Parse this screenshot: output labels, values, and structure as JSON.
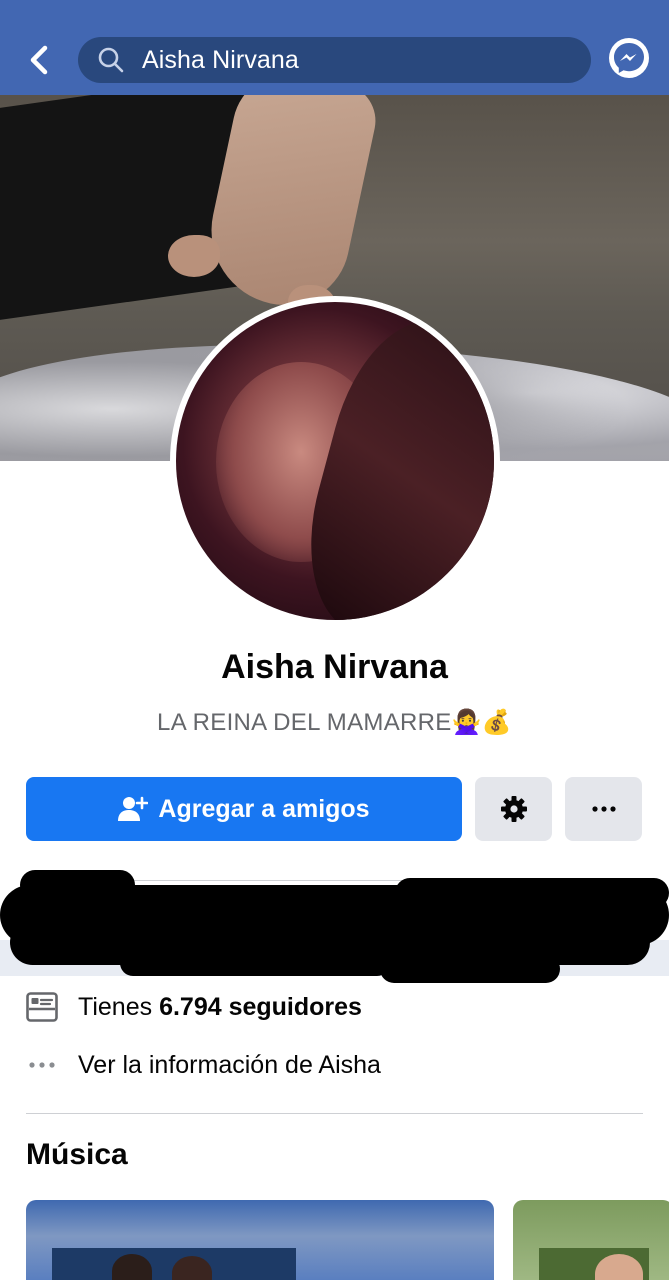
{
  "header": {
    "back_icon": "chevron-left-icon",
    "search_icon": "search-icon",
    "search_value": "Aisha Nirvana",
    "messenger_icon": "messenger-icon"
  },
  "profile": {
    "name": "Aisha Nirvana",
    "bio": "LA REINA DEL MAMARRE🙅‍♀️💰"
  },
  "actions": {
    "add_friend_label": "Agregar a amigos",
    "add_friend_icon": "add-friend-icon",
    "settings_icon": "gear-icon",
    "more_icon": "more-dots-icon"
  },
  "info": {
    "followers_prefix": "Tienes ",
    "followers_count": "6.794 seguidores",
    "about_link": "Ver la información de Aisha"
  },
  "music": {
    "title": "Música"
  },
  "colors": {
    "header_bg": "#4267b2",
    "primary_button": "#1877f2",
    "secondary_button": "#e4e6eb",
    "muted_text": "#65676b"
  }
}
